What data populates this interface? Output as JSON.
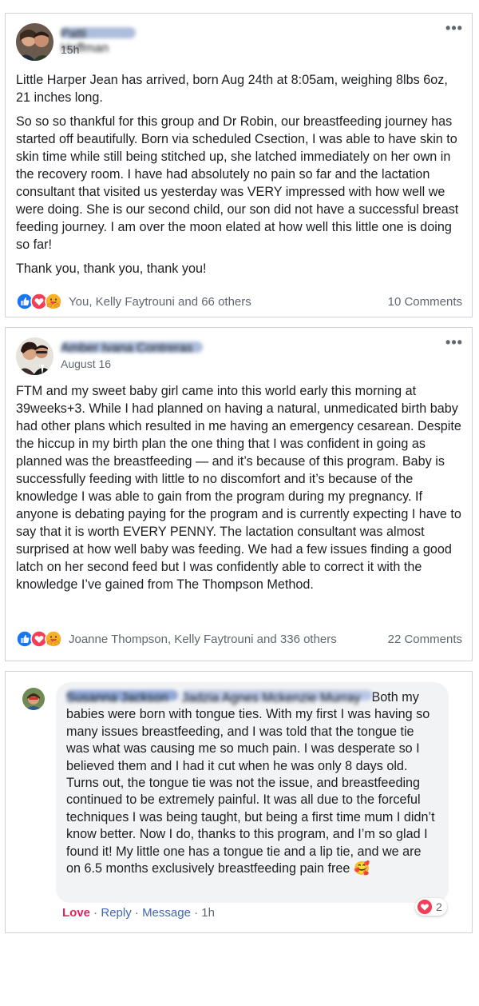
{
  "posts": [
    {
      "author": "Patti Hoffman",
      "timestamp": "15h",
      "paragraphs": [
        "Little Harper Jean has arrived, born Aug 24th at 8:05am, weighing 8lbs 6oz, 21 inches long.",
        "So so so thankful for this group and Dr Robin, our breastfeeding journey has started off beautifully. Born via scheduled Csection, I was able to have skin to skin time while still being stitched up, she latched immediately on her own in the recovery room. I have had absolutely no pain so far and the lactation consultant that visited us yesterday was VERY impressed with how well we were doing. She is our second child, our son did not have a successful breast feeding journey. I am over the moon elated at how well this little one is doing so far!",
        "Thank you, thank you, thank you!"
      ],
      "reaction_names": "You, Kelly Faytrouni and 66 others",
      "comments": "10 Comments"
    },
    {
      "author": "Amber Ivana Contreras",
      "timestamp": "August 16",
      "paragraphs": [
        "FTM and my sweet baby girl came into this world early this morning at 39weeks+3. While I had planned on having a natural, unmedicated birth baby had other plans which resulted in me having an emergency cesarean. Despite the hiccup in my birth plan the one thing that I was confident in going as planned was the breastfeeding — and it’s because of this program. Baby is successfully feeding with little to no discomfort and it’s because of the knowledge I was able to gain from the program during my pregnancy. If anyone is debating paying for the program and is currently expecting I have to say that it is worth EVERY PENNY. The lactation consultant was almost surprised at how well baby was feeding. We had a few issues finding a good latch on her second feed but I was confidently able to correct it with the knowledge I’ve gained from The Thompson Method."
      ],
      "reaction_names": "Joanne Thompson, Kelly Faytrouni and 336 others",
      "comments": "22 Comments"
    }
  ],
  "comment": {
    "author": "Susanna Jackson",
    "tagged": "Jadzia Agnes Mckenzie Murray",
    "text": "Both my babies were born with tongue ties. With my first I was having so many issues breastfeeding, and I was told that the tongue tie was what was causing me so much pain. I was desperate so I believed them and I had it cut when he was only 8 days old. Turns out, the tongue tie was not the issue, and breastfeeding continued to be extremely painful. It was all due to the forceful techniques I was being taught, but being a first time mum I didn’t know better. Now I do, thanks to this program, and I’m so glad I found it! My little one has a tongue tie and a lip tie, and we are on 6.5 months exclusively breastfeeding pain free",
    "emoji": "🥰",
    "actions": {
      "love": "Love",
      "reply": "Reply",
      "message": "Message",
      "time": "1h",
      "separator": " · "
    },
    "love_count": "2"
  },
  "icons": {
    "like": "thumbs-up-icon",
    "love": "heart-icon",
    "care": "care-hug-icon",
    "more": "more-options-icon"
  },
  "colors": {
    "like_blue": "#1877f2",
    "love_red": "#f33e58",
    "care_yellow": "#f7b125",
    "link_blue": "#4267b2",
    "love_text": "#e0245e",
    "bubble_bg": "#f2f3f5",
    "card_border": "#cfd2d6",
    "muted_text": "#606770"
  }
}
